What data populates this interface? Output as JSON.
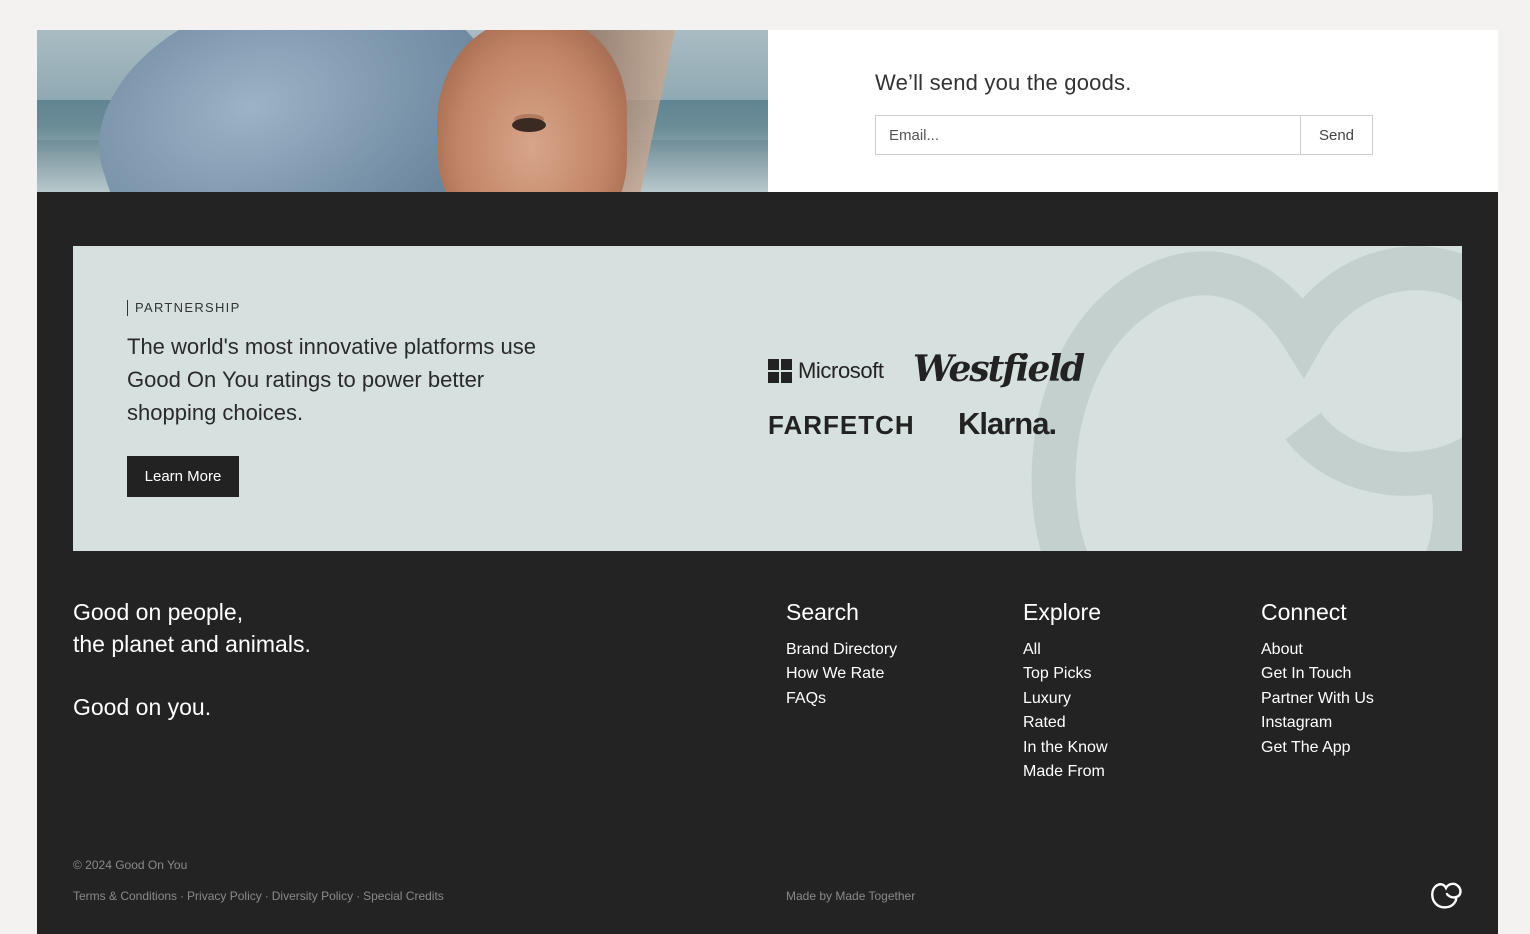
{
  "signup": {
    "heading": "We’ll send you the goods.",
    "email_placeholder": "Email...",
    "send_label": "Send"
  },
  "partnership": {
    "eyebrow": "PARTNERSHIP",
    "lead": "The world's most innovative platforms use Good On You ratings to power better shopping choices.",
    "button_label": "Learn More",
    "logos": {
      "microsoft": "Microsoft",
      "westfield": "Westfield",
      "farfetch": "FARFETCH",
      "klarna": "Klarna."
    }
  },
  "footer": {
    "tagline_line1": "Good on people,",
    "tagline_line2": "the planet and animals.",
    "tagline_closing": "Good on you.",
    "search": {
      "heading": "Search",
      "links": [
        "Brand Directory",
        "How We Rate",
        "FAQs"
      ]
    },
    "explore": {
      "heading": "Explore",
      "links": [
        "All",
        "Top Picks",
        "Luxury",
        "Rated",
        "In the Know",
        "Made From"
      ]
    },
    "connect": {
      "heading": "Connect",
      "links": [
        "About",
        "Get In Touch",
        "Partner With Us",
        "Instagram",
        "Get The App"
      ]
    },
    "copyright": "© 2024 Good On You",
    "legal": [
      "Terms & Conditions",
      "Privacy Policy",
      "Diversity Policy",
      "Special Credits"
    ],
    "legal_separator": "·",
    "made_by": "Made by Made Together"
  }
}
